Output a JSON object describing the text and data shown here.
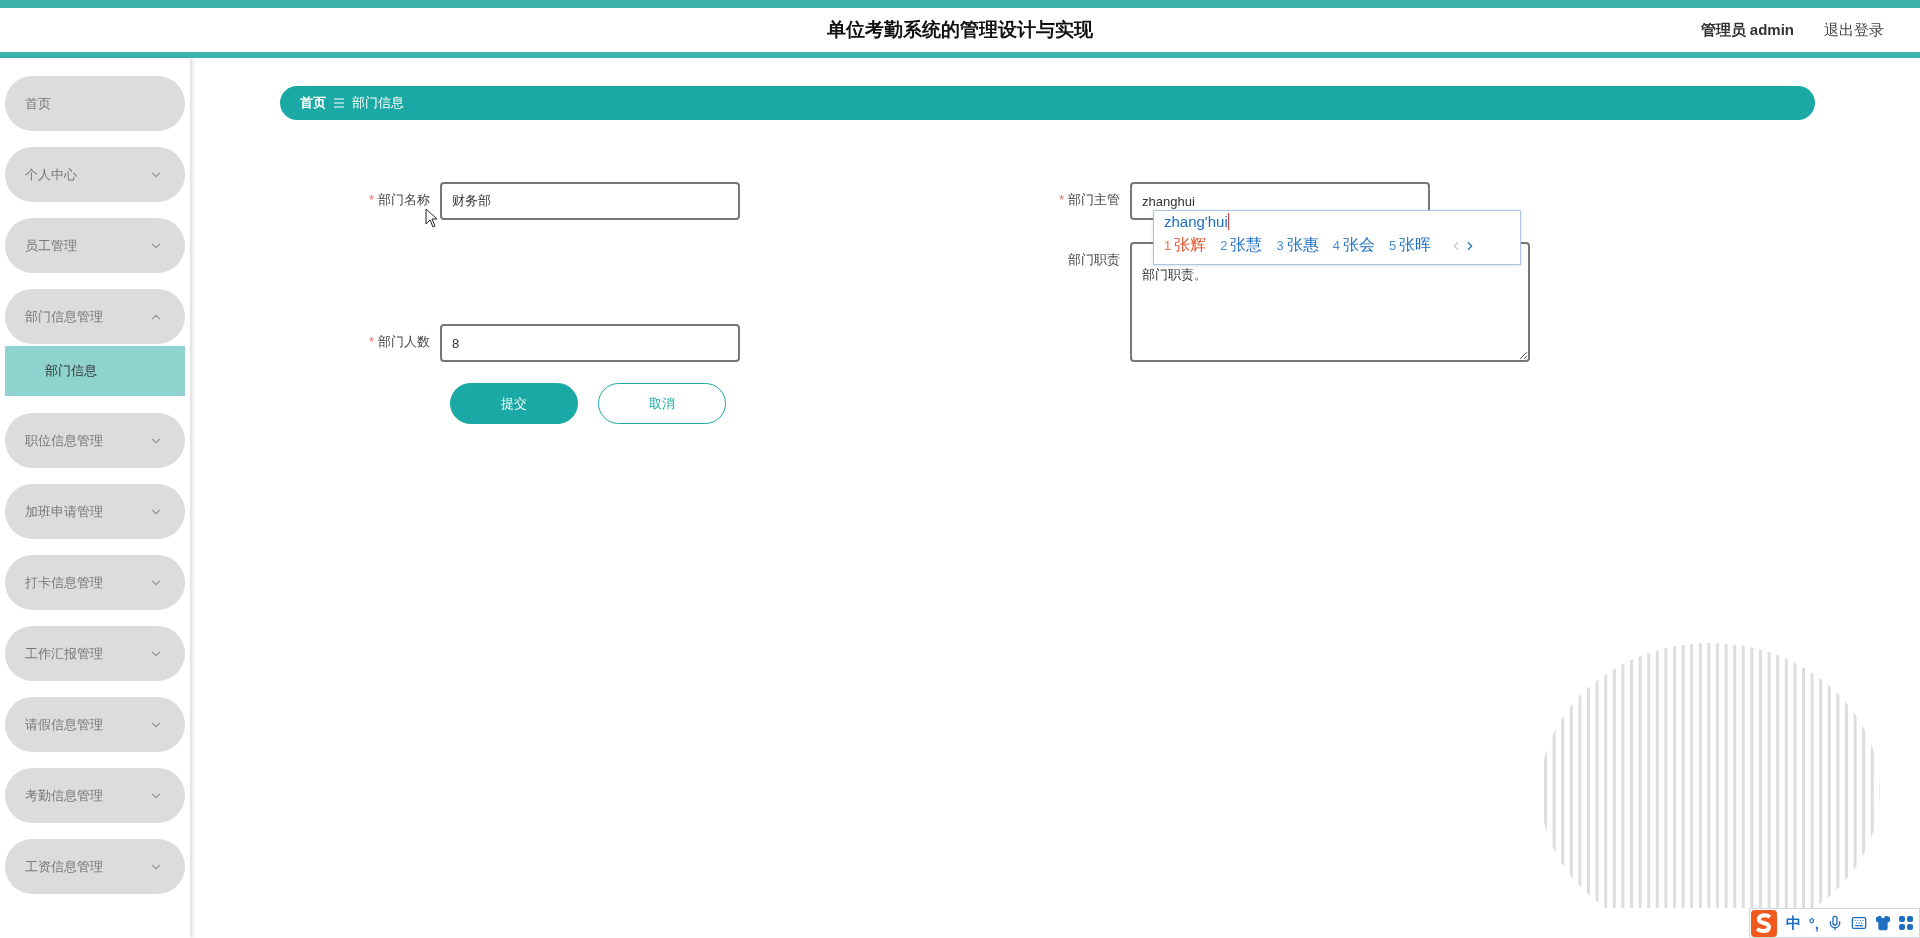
{
  "header": {
    "title": "单位考勤系统的管理设计与实现",
    "user": "管理员 admin",
    "logout": "退出登录"
  },
  "sidebar": {
    "items": [
      {
        "label": "首页",
        "expandable": false
      },
      {
        "label": "个人中心",
        "expandable": true,
        "expanded": false
      },
      {
        "label": "员工管理",
        "expandable": true,
        "expanded": false
      },
      {
        "label": "部门信息管理",
        "expandable": true,
        "expanded": true,
        "children": [
          {
            "label": "部门信息",
            "selected": true
          }
        ]
      },
      {
        "label": "职位信息管理",
        "expandable": true,
        "expanded": false
      },
      {
        "label": "加班申请管理",
        "expandable": true,
        "expanded": false
      },
      {
        "label": "打卡信息管理",
        "expandable": true,
        "expanded": false
      },
      {
        "label": "工作汇报管理",
        "expandable": true,
        "expanded": false
      },
      {
        "label": "请假信息管理",
        "expandable": true,
        "expanded": false
      },
      {
        "label": "考勤信息管理",
        "expandable": true,
        "expanded": false
      },
      {
        "label": "工资信息管理",
        "expandable": true,
        "expanded": false
      }
    ]
  },
  "breadcrumb": {
    "items": [
      "首页",
      "部门信息"
    ]
  },
  "form": {
    "columns": [
      [
        {
          "label": "部门名称",
          "required_mark": "*",
          "kind": "input",
          "value": "财务部"
        },
        {
          "label": "部门人数",
          "required_mark": "*",
          "kind": "input",
          "value": "8"
        }
      ],
      [
        {
          "label": "部门主管",
          "required_mark": "*",
          "kind": "input",
          "value": "zhanghui",
          "ime": true
        },
        {
          "label": "部门职责",
          "kind": "textarea",
          "value": "部门职责。"
        }
      ]
    ],
    "buttons": [
      {
        "label": "提交",
        "kind": "primary"
      },
      {
        "label": "取消",
        "kind": "secondary"
      }
    ]
  },
  "ime": {
    "composition": "zhang'hui",
    "candidates": [
      {
        "index": "1",
        "text": "张辉",
        "selected": true
      },
      {
        "index": "2",
        "text": "张慧",
        "selected": false
      },
      {
        "index": "3",
        "text": "张惠",
        "selected": false
      },
      {
        "index": "4",
        "text": "张会",
        "selected": false
      },
      {
        "index": "5",
        "text": "张晖",
        "selected": false
      }
    ]
  },
  "ime_toolbar": {
    "mode": "中",
    "punctuation": "°,"
  }
}
